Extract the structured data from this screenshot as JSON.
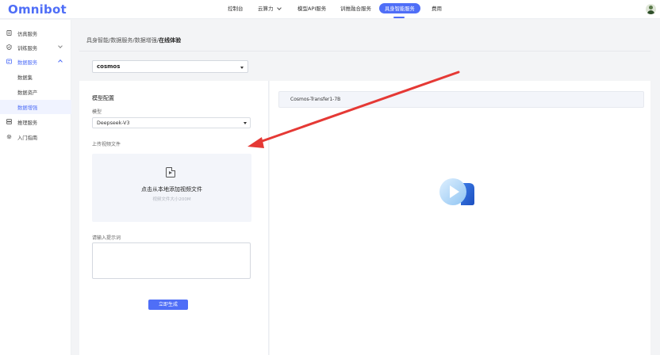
{
  "app": {
    "logo_text": "Omnibot"
  },
  "topnav": {
    "items": [
      {
        "label": "控制台"
      },
      {
        "label": "云算力"
      },
      {
        "label": "模型API服务"
      },
      {
        "label": "训推融合服务"
      },
      {
        "label": "具身智能服务",
        "active": true
      },
      {
        "label": "费用"
      }
    ]
  },
  "sidebar": {
    "items": [
      {
        "label": "仿真服务"
      },
      {
        "label": "训练服务"
      },
      {
        "label": "数据服务"
      },
      {
        "label": "数据集"
      },
      {
        "label": "数据资产"
      },
      {
        "label": "数据增强"
      },
      {
        "label": "推理服务"
      },
      {
        "label": "入门指南"
      }
    ]
  },
  "breadcrumb": {
    "path": "具身智能/数据服务/数据增强/",
    "current": "在线体验"
  },
  "top_select": {
    "value": "cosmos"
  },
  "config": {
    "section_title": "模型配置",
    "model_label": "模型",
    "model_value": "Deepseek-V3",
    "upload_label": "上传视频文件",
    "upload_title": "点击从本地添加视频文件",
    "upload_hint": "视频文件大小200M",
    "prompt_label": "请输入提示词",
    "prompt_value": "",
    "generate_label": "立即生成"
  },
  "preview": {
    "model_name": "Cosmos-Transfer1-7B"
  },
  "colors": {
    "accent": "#4f6ef7",
    "annotation_arrow": "#e53935"
  }
}
